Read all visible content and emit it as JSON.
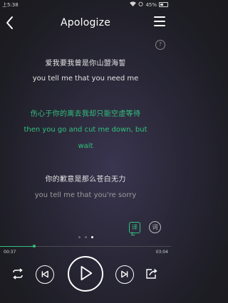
{
  "status": {
    "carrier_time": "上5:38",
    "battery": "45%"
  },
  "header": {
    "title": "Apologize"
  },
  "lyrics": [
    {
      "zh": "爱我要我曾是你山盟海誓",
      "en": "you tell me that you need me",
      "state": "dim"
    },
    {
      "zh": "伤心于你的离去我却只能空虚等待",
      "en": [
        "then you go and cut me down, but",
        "wait"
      ],
      "state": "active"
    },
    {
      "zh": "你的歉意是那么苍白无力",
      "en": "you tell me that you're sorry",
      "state": "faded"
    }
  ],
  "buttons": {
    "translate": "译",
    "word": "词"
  },
  "playback": {
    "current": "00:37",
    "total": "03:04",
    "progress": 0.2
  },
  "colors": {
    "accent": "#31c27c"
  },
  "pager": {
    "count": 3,
    "active_index": 2
  },
  "icons": [
    "back-icon",
    "menu-icon",
    "help-icon",
    "repeat-icon",
    "previous-icon",
    "play-icon",
    "next-icon",
    "share-icon"
  ]
}
